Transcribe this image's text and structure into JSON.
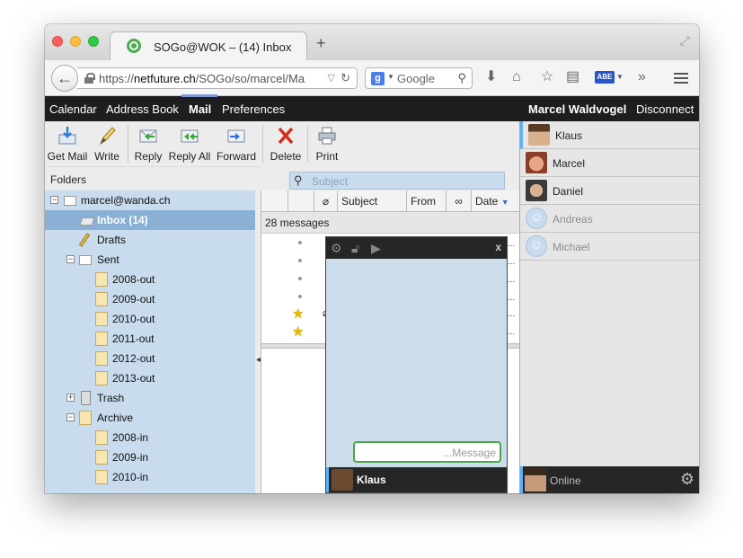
{
  "browser": {
    "tab_title": "SOGo@WOK – (14) Inbox",
    "new_tab": "+",
    "url_host": "netfuture.ch",
    "url_prefix": "https://",
    "url_path": "/SOGo/so/marcel/Ma",
    "search_engine_letter": "g",
    "search_placeholder": "Google",
    "abe_badge": "ABE",
    "overflow": "»"
  },
  "app": {
    "modules": [
      {
        "label": "Calendar"
      },
      {
        "label": "Address Book"
      },
      {
        "label": "Mail",
        "active": true
      },
      {
        "label": "Preferences"
      }
    ],
    "user_name": "Marcel Waldvogel",
    "disconnect": "Disconnect"
  },
  "toolbar": {
    "buttons": [
      {
        "label": "Get Mail",
        "icon": "get-mail-icon"
      },
      {
        "label": "Write",
        "icon": "pencil-icon"
      },
      {
        "label": "Reply",
        "icon": "reply-icon"
      },
      {
        "label": "Reply All",
        "icon": "reply-all-icon"
      },
      {
        "label": "Forward",
        "icon": "forward-icon"
      },
      {
        "label": "Delete",
        "icon": "delete-icon"
      },
      {
        "label": "Print",
        "icon": "printer-icon"
      }
    ]
  },
  "folders": {
    "title": "Folders",
    "account": "marcel@wanda.ch",
    "items": [
      {
        "label": "Inbox (14)",
        "selected": true
      },
      {
        "label": "Drafts"
      },
      {
        "label": "Sent"
      },
      {
        "label": "2008-out"
      },
      {
        "label": "2009-out"
      },
      {
        "label": "2010-out"
      },
      {
        "label": "2011-out"
      },
      {
        "label": "2012-out"
      },
      {
        "label": "2013-out"
      },
      {
        "label": "Trash"
      },
      {
        "label": "Archive"
      },
      {
        "label": "2008-in"
      },
      {
        "label": "2009-in"
      },
      {
        "label": "2010-in"
      }
    ],
    "toggle_collapse": "−",
    "toggle_expand": "+"
  },
  "messages": {
    "search_placeholder": "Subject",
    "columns": [
      "Subject",
      "From",
      "Date"
    ],
    "count_text": "28 messages",
    "trail": "..."
  },
  "chat": {
    "close": "x",
    "input_placeholder": "...Message",
    "active_contact": "Klaus"
  },
  "contacts": {
    "items": [
      {
        "name": "Klaus",
        "online": true
      },
      {
        "name": "Marcel",
        "online": true
      },
      {
        "name": "Daniel",
        "online": true
      },
      {
        "name": "Andreas",
        "online": false
      },
      {
        "name": "Michael",
        "online": false
      }
    ],
    "status": "Online"
  }
}
